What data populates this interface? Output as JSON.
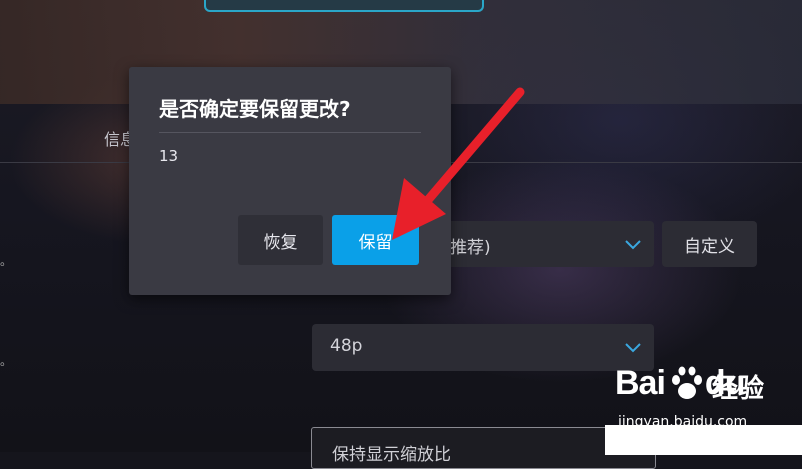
{
  "background": {
    "nav_label": "信息",
    "side_marks": [
      "。",
      "。"
    ]
  },
  "settings": {
    "scaling_select": {
      "value": "推荐)"
    },
    "custom_button": "自定义",
    "refresh_select": {
      "value": "48p"
    },
    "scale_mode_input": {
      "value": "保持显示缩放比"
    }
  },
  "dialog": {
    "title": "是否确定要保留更改?",
    "countdown": "13",
    "revert_label": "恢复",
    "keep_label": "保留"
  },
  "colors": {
    "primary_button": "#0aa0e8",
    "dialog_bg": "#3a3a43",
    "arrow": "#e8202a"
  },
  "watermark": {
    "logo_text": "Bai",
    "logo_text_2": "du",
    "product": "经验",
    "url": "jingyan.baidu.com"
  }
}
